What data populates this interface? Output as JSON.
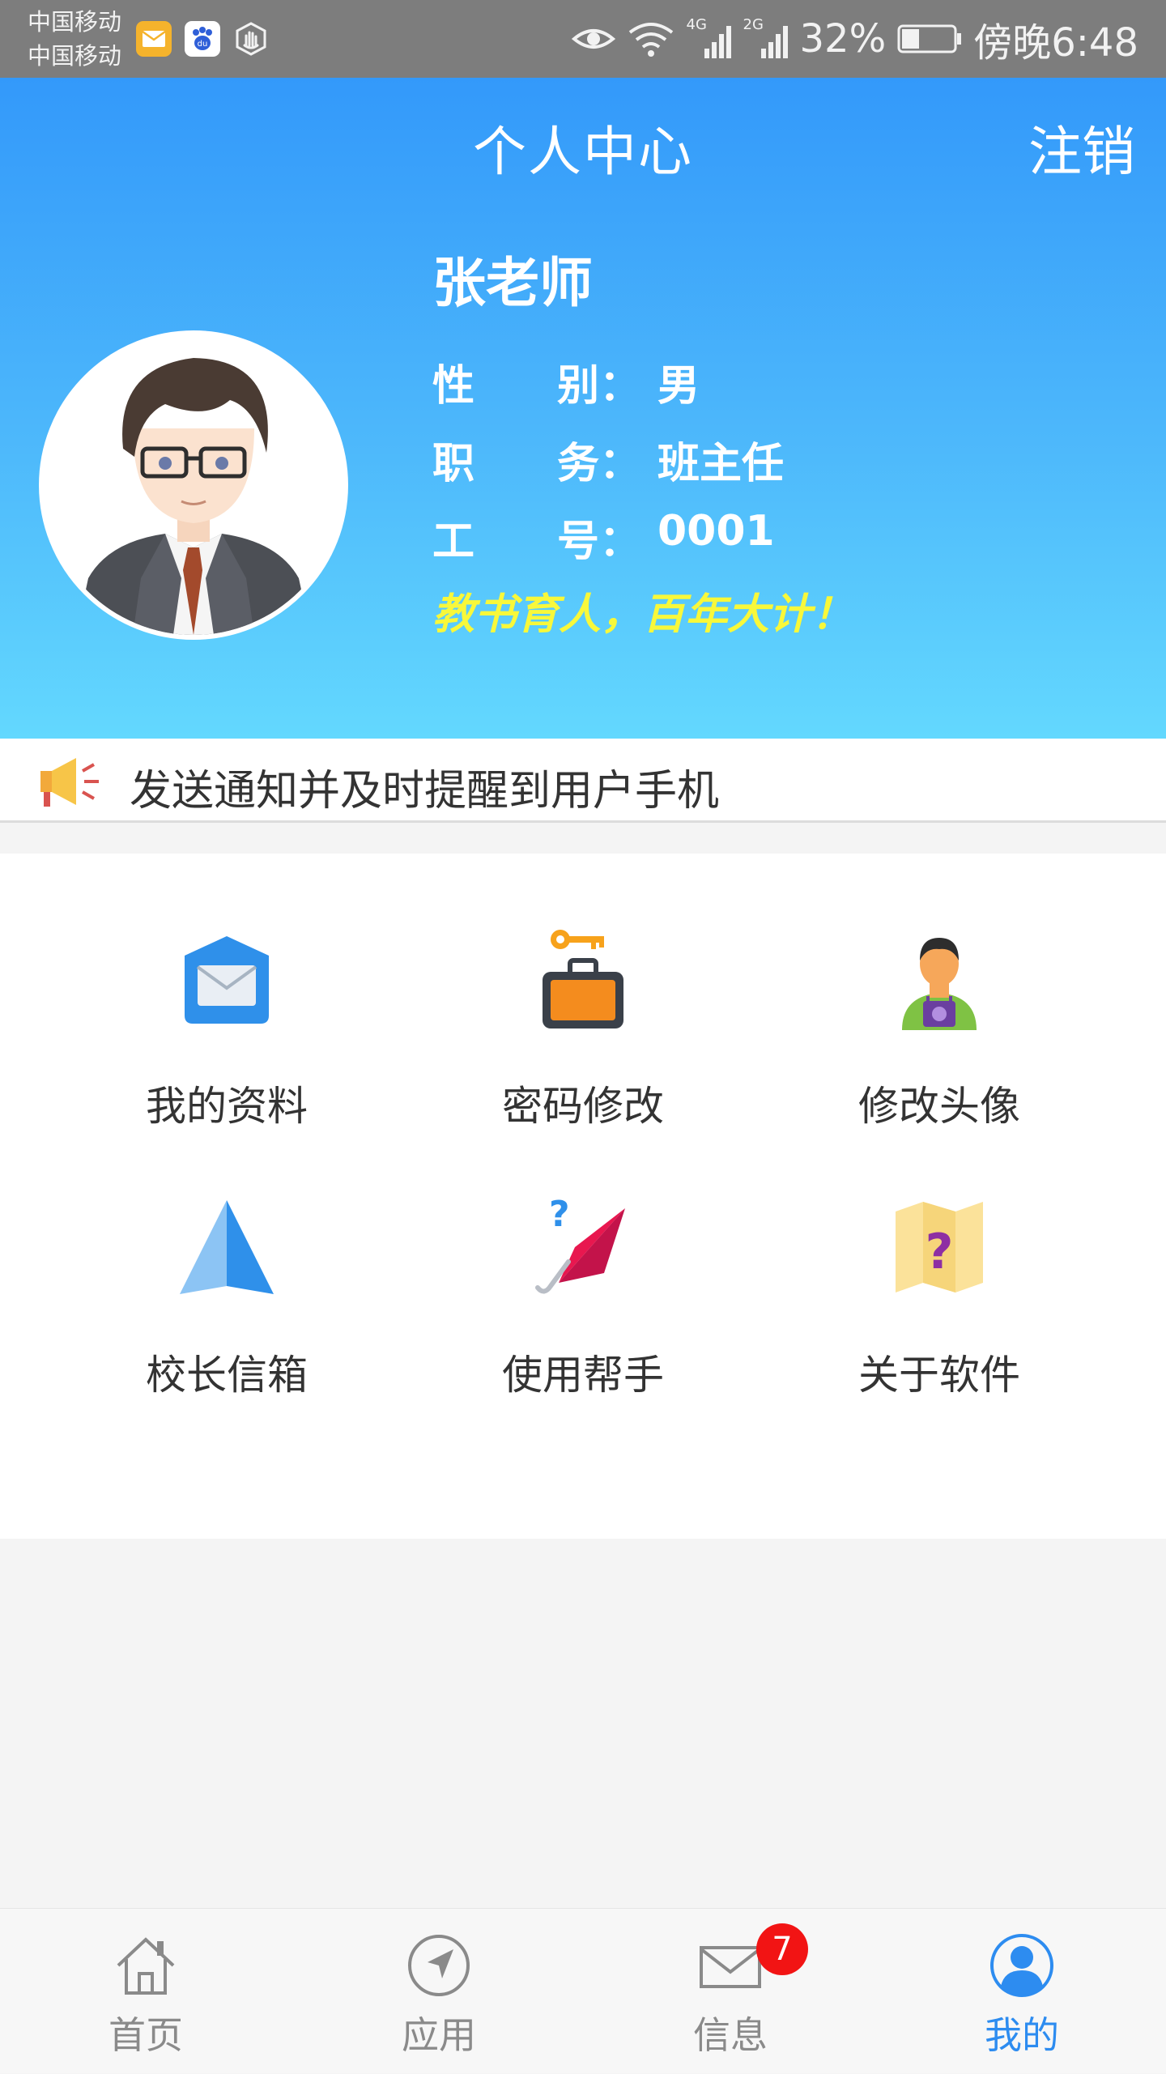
{
  "status_bar": {
    "carrier_1": "中国移动",
    "carrier_2": "中国移动",
    "network_1": "4G",
    "network_2": "2G",
    "battery": "32%",
    "time": "傍晚6:48",
    "icons": [
      "mail-app-icon",
      "baidu-app-icon",
      "hand-app-icon",
      "eye-icon",
      "wifi-icon",
      "signal-icon",
      "battery-icon"
    ]
  },
  "header": {
    "title": "个人中心",
    "logout_label": "注销",
    "background_top": "#3399fa",
    "background_bottom": "#63d8fe"
  },
  "profile": {
    "name": "张老师",
    "gender_label_a": "性",
    "gender_label_b": "别：",
    "gender": "男",
    "position_label_a": "职",
    "position_label_b": "务：",
    "position": "班主任",
    "id_label_a": "工",
    "id_label_b": "号：",
    "id": "0001",
    "motto": "教书育人，百年大计！",
    "motto_color": "#f8f83a"
  },
  "notice": {
    "icon": "megaphone-icon",
    "text": "发送通知并及时提醒到用户手机"
  },
  "menu": {
    "items": [
      {
        "label": "我的资料",
        "icon": "envelope-icon"
      },
      {
        "label": "密码修改",
        "icon": "key-briefcase-icon"
      },
      {
        "label": "修改头像",
        "icon": "person-camera-icon"
      },
      {
        "label": "校长信箱",
        "icon": "navigation-arrow-icon"
      },
      {
        "label": "使用帮手",
        "icon": "umbrella-question-icon"
      },
      {
        "label": "关于软件",
        "icon": "map-question-icon"
      }
    ]
  },
  "tabbar": {
    "tabs": [
      {
        "label": "首页",
        "icon": "home-icon"
      },
      {
        "label": "应用",
        "icon": "compass-icon"
      },
      {
        "label": "信息",
        "icon": "mail-icon",
        "badge": "7"
      },
      {
        "label": "我的",
        "icon": "user-icon",
        "active": true
      }
    ],
    "active_color": "#2d8cf0",
    "inactive_color": "#8a8a8a"
  }
}
